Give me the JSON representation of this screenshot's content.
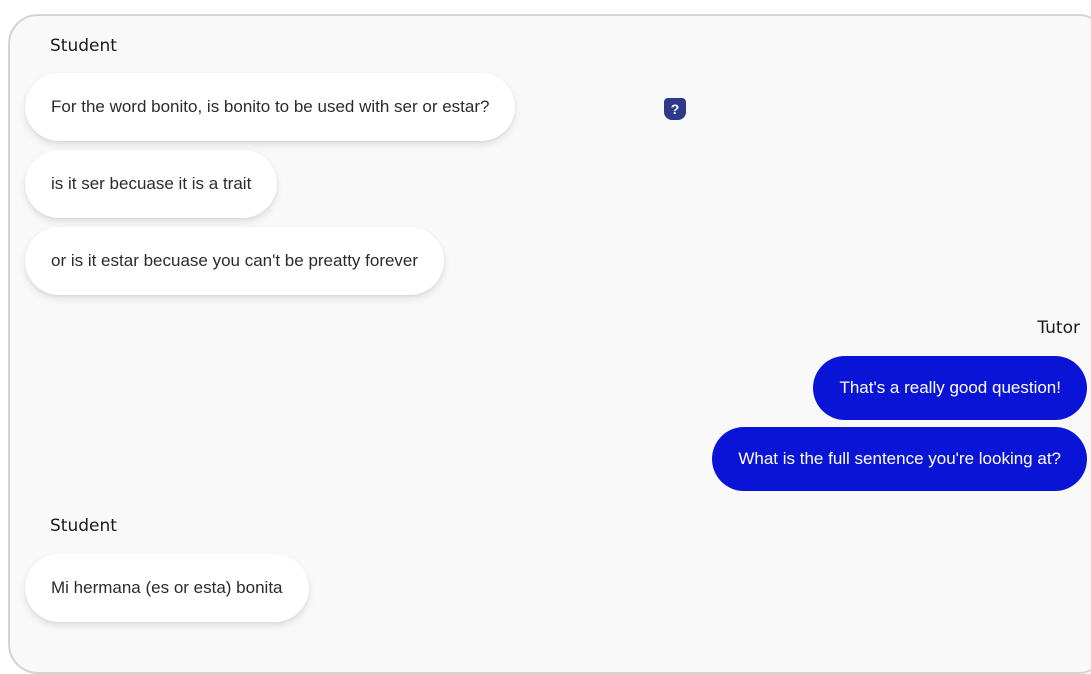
{
  "conversation": {
    "blocks": [
      {
        "sender": "Student",
        "messages": [
          "For the word bonito, is bonito to be used with ser or estar?",
          "is it ser becuase it is a trait",
          "or is it estar becuase you can't be preatty forever"
        ]
      },
      {
        "sender": "Tutor",
        "messages": [
          "That's a really good question!",
          "What is the full sentence you're looking at?"
        ]
      },
      {
        "sender": "Student",
        "messages": [
          "Mi hermana (es or esta) bonita"
        ]
      }
    ]
  },
  "icons": {
    "question_flag": "?"
  },
  "colors": {
    "tutor_bubble": "#0a14d6",
    "student_bubble": "#ffffff",
    "help_icon": "#2d3a8c"
  }
}
